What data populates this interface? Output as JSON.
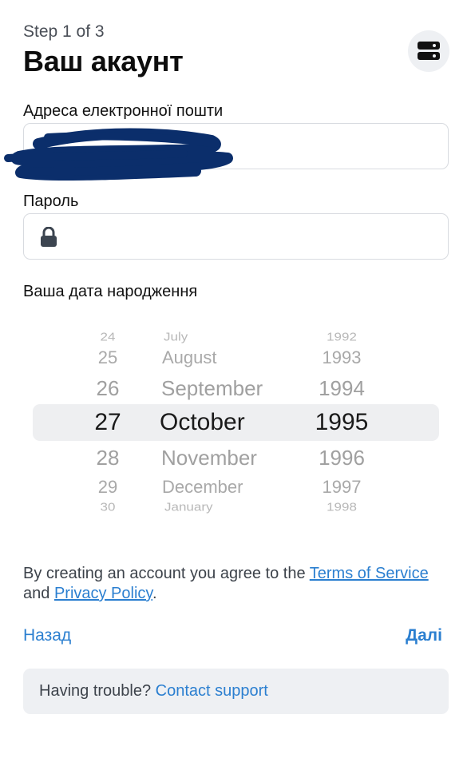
{
  "header": {
    "step": "Step 1 of 3",
    "title": "Ваш акаунт",
    "server_icon": "server-stack-icon"
  },
  "form": {
    "email_label": "Адреса електронної пошти",
    "email_value_redacted": true,
    "password_label": "Пароль",
    "password_icon": "lock-icon",
    "dob_label": "Ваша дата народження"
  },
  "date_picker": {
    "days": [
      "24",
      "25",
      "26",
      "27",
      "28",
      "29",
      "30"
    ],
    "months": [
      "July",
      "August",
      "September",
      "October",
      "November",
      "December",
      "January"
    ],
    "years": [
      "1992",
      "1993",
      "1994",
      "1995",
      "1996",
      "1997",
      "1998"
    ],
    "selected": {
      "day": "27",
      "month": "October",
      "year": "1995"
    }
  },
  "terms": {
    "prefix": "By creating an account you agree to the ",
    "terms_link": "Terms of Service",
    "middle": " and ",
    "privacy_link": "Privacy Policy",
    "suffix": "."
  },
  "nav": {
    "back_label": "Назад",
    "next_label": "Далі"
  },
  "help": {
    "prefix": "Having trouble? ",
    "link": "Contact support"
  },
  "colors": {
    "accent": "#2b7fd0",
    "redaction": "#0b2e6b",
    "panel": "#eef0f3"
  }
}
